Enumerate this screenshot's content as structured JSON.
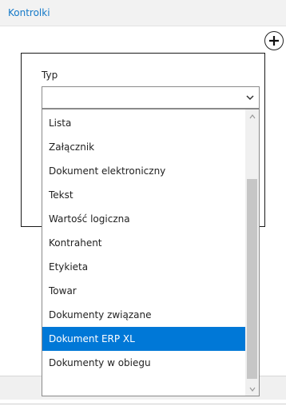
{
  "header": {
    "title": "Kontrolki"
  },
  "add_button": {
    "icon": "plus-icon"
  },
  "field": {
    "label": "Typ",
    "selected_value": "",
    "dropdown_icon": "chevron-down-icon"
  },
  "dropdown": {
    "items": [
      {
        "label": "Lista",
        "selected": false
      },
      {
        "label": "Załącznik",
        "selected": false
      },
      {
        "label": "Dokument elektroniczny",
        "selected": false
      },
      {
        "label": "Tekst",
        "selected": false
      },
      {
        "label": "Wartość logiczna",
        "selected": false
      },
      {
        "label": "Kontrahent",
        "selected": false
      },
      {
        "label": "Etykieta",
        "selected": false
      },
      {
        "label": "Towar",
        "selected": false
      },
      {
        "label": "Dokumenty związane",
        "selected": false
      },
      {
        "label": "Dokument ERP XL",
        "selected": true
      },
      {
        "label": "Dokumenty w obiegu",
        "selected": false
      }
    ],
    "highlight_color": "#0078d7"
  },
  "colors": {
    "header_title": "#1479c8",
    "selection": "#0078d7"
  }
}
